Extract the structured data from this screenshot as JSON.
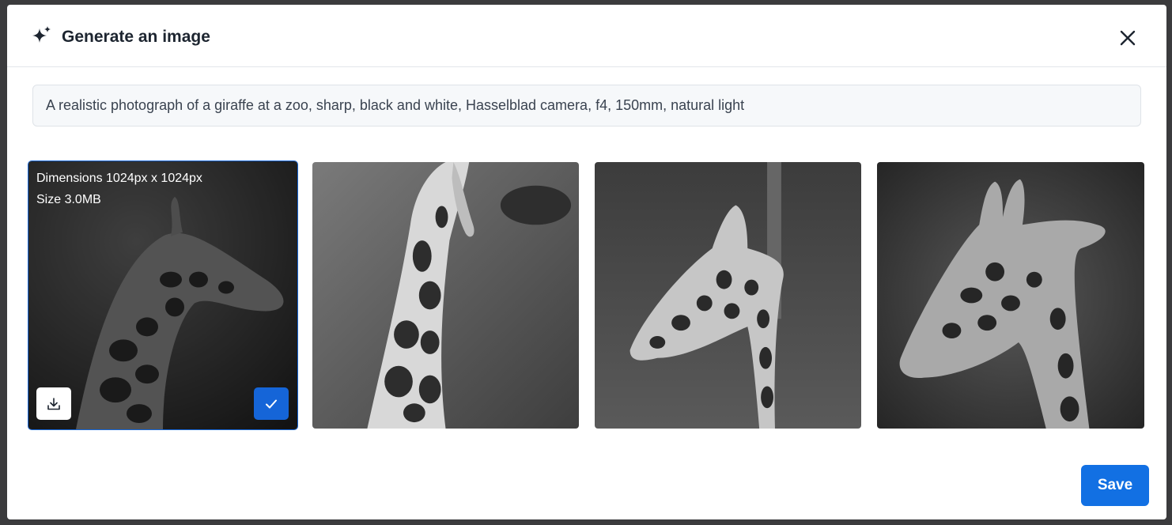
{
  "dialog": {
    "title": "Generate an image",
    "title_icon": "sparkle-icon",
    "close_icon": "close-icon"
  },
  "prompt": {
    "value": "A realistic photograph of a giraffe at a zoo, sharp, black and white, Hasselblad camera, f4, 150mm, natural light"
  },
  "images": [
    {
      "alt": "giraffe-1",
      "selected": true,
      "dimensions_label": "Dimensions 1024px x 1024px",
      "size_label": "Size 3.0MB",
      "download_icon": "download-icon",
      "check_icon": "check-icon"
    },
    {
      "alt": "giraffe-2",
      "selected": false
    },
    {
      "alt": "giraffe-3",
      "selected": false
    },
    {
      "alt": "giraffe-4",
      "selected": false
    }
  ],
  "footer": {
    "save_label": "Save"
  },
  "colors": {
    "accent": "#1270e3",
    "selected_border": "#1565d8",
    "title_text": "#1d2530",
    "prompt_bg": "#f6f8fa"
  }
}
